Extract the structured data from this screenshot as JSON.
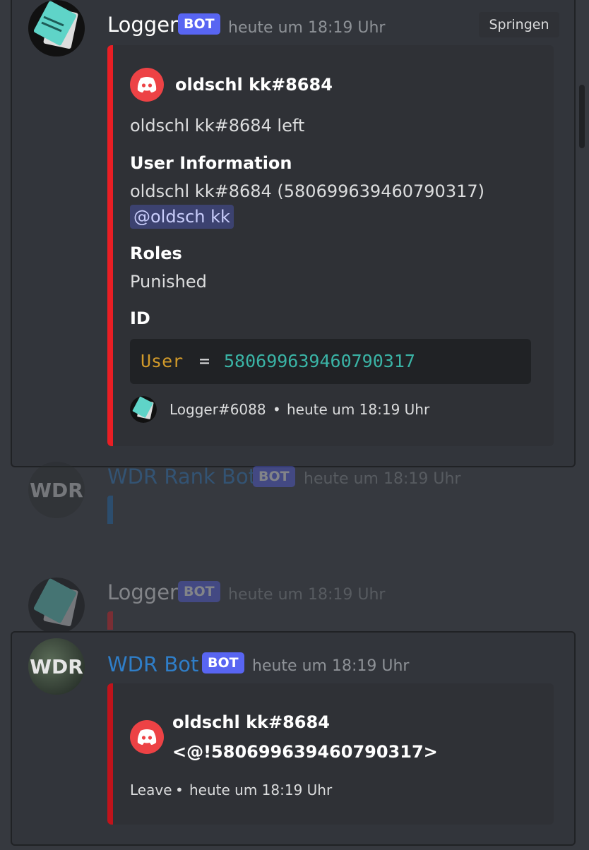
{
  "message1": {
    "username": "Logger",
    "bot_tag": "BOT",
    "timestamp": "heute um 18:19 Uhr",
    "jump_button": "Springen",
    "embed": {
      "author": "oldschl kk#8684",
      "description": "oldschl kk#8684 left",
      "field1_name": "User Information",
      "field1_value": "oldschl kk#8684 (580699639460790317)",
      "mention": "@oldsch kk",
      "field2_name": "Roles",
      "field2_value": "Punished",
      "field3_name": "ID",
      "code_key": "User",
      "code_op": "=",
      "code_value": "580699639460790317",
      "footer_name": "Logger#6088",
      "footer_sep": "•",
      "footer_time": "heute um 18:19 Uhr",
      "accent_color": "#e91e24"
    }
  },
  "message2": {
    "username": "WDR Rank Bot",
    "bot_tag": "BOT",
    "timestamp": "heute um 18:19 Uhr",
    "avatar_text": "WDR",
    "accent_color": "#1e6fb8"
  },
  "message3": {
    "username": "Logger",
    "bot_tag": "BOT",
    "timestamp": "heute um 18:19 Uhr"
  },
  "message4": {
    "username": "WDR Bot",
    "bot_tag": "BOT",
    "timestamp": "heute um 18:19 Uhr",
    "avatar_text": "WDR",
    "embed": {
      "author": "oldschl kk#8684",
      "mention_raw": "<@!580699639460790317>",
      "footer_text": "Leave",
      "footer_sep": "•",
      "footer_time": "heute um 18:19 Uhr",
      "accent_color": "#c0131b"
    }
  },
  "colors": {
    "background": "#36393f",
    "blurple": "#5865f2",
    "wdr_name": "#2f7ec8",
    "code_key": "#d19a2a",
    "code_value": "#3ab4a6",
    "mention_bg": "#3c4270",
    "mention_text": "#c9cdfb"
  }
}
